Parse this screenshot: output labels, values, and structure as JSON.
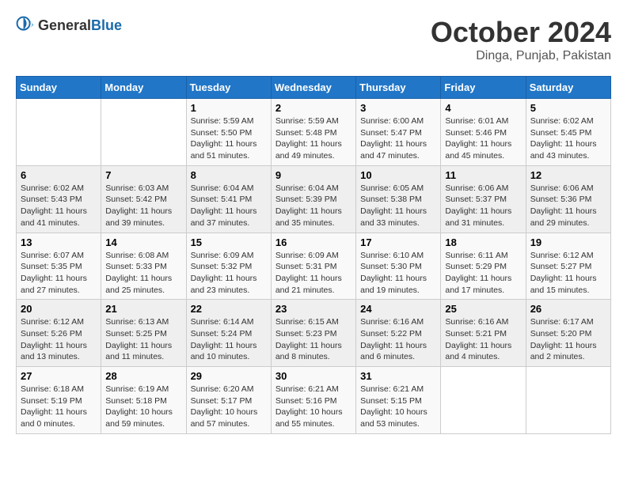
{
  "header": {
    "logo": {
      "general": "General",
      "blue": "Blue"
    },
    "title": "October 2024",
    "location": "Dinga, Punjab, Pakistan"
  },
  "weekdays": [
    "Sunday",
    "Monday",
    "Tuesday",
    "Wednesday",
    "Thursday",
    "Friday",
    "Saturday"
  ],
  "weeks": [
    [
      {
        "day": null
      },
      {
        "day": null
      },
      {
        "day": 1,
        "sunrise": "Sunrise: 5:59 AM",
        "sunset": "Sunset: 5:50 PM",
        "daylight": "Daylight: 11 hours and 51 minutes."
      },
      {
        "day": 2,
        "sunrise": "Sunrise: 5:59 AM",
        "sunset": "Sunset: 5:48 PM",
        "daylight": "Daylight: 11 hours and 49 minutes."
      },
      {
        "day": 3,
        "sunrise": "Sunrise: 6:00 AM",
        "sunset": "Sunset: 5:47 PM",
        "daylight": "Daylight: 11 hours and 47 minutes."
      },
      {
        "day": 4,
        "sunrise": "Sunrise: 6:01 AM",
        "sunset": "Sunset: 5:46 PM",
        "daylight": "Daylight: 11 hours and 45 minutes."
      },
      {
        "day": 5,
        "sunrise": "Sunrise: 6:02 AM",
        "sunset": "Sunset: 5:45 PM",
        "daylight": "Daylight: 11 hours and 43 minutes."
      }
    ],
    [
      {
        "day": 6,
        "sunrise": "Sunrise: 6:02 AM",
        "sunset": "Sunset: 5:43 PM",
        "daylight": "Daylight: 11 hours and 41 minutes."
      },
      {
        "day": 7,
        "sunrise": "Sunrise: 6:03 AM",
        "sunset": "Sunset: 5:42 PM",
        "daylight": "Daylight: 11 hours and 39 minutes."
      },
      {
        "day": 8,
        "sunrise": "Sunrise: 6:04 AM",
        "sunset": "Sunset: 5:41 PM",
        "daylight": "Daylight: 11 hours and 37 minutes."
      },
      {
        "day": 9,
        "sunrise": "Sunrise: 6:04 AM",
        "sunset": "Sunset: 5:39 PM",
        "daylight": "Daylight: 11 hours and 35 minutes."
      },
      {
        "day": 10,
        "sunrise": "Sunrise: 6:05 AM",
        "sunset": "Sunset: 5:38 PM",
        "daylight": "Daylight: 11 hours and 33 minutes."
      },
      {
        "day": 11,
        "sunrise": "Sunrise: 6:06 AM",
        "sunset": "Sunset: 5:37 PM",
        "daylight": "Daylight: 11 hours and 31 minutes."
      },
      {
        "day": 12,
        "sunrise": "Sunrise: 6:06 AM",
        "sunset": "Sunset: 5:36 PM",
        "daylight": "Daylight: 11 hours and 29 minutes."
      }
    ],
    [
      {
        "day": 13,
        "sunrise": "Sunrise: 6:07 AM",
        "sunset": "Sunset: 5:35 PM",
        "daylight": "Daylight: 11 hours and 27 minutes."
      },
      {
        "day": 14,
        "sunrise": "Sunrise: 6:08 AM",
        "sunset": "Sunset: 5:33 PM",
        "daylight": "Daylight: 11 hours and 25 minutes."
      },
      {
        "day": 15,
        "sunrise": "Sunrise: 6:09 AM",
        "sunset": "Sunset: 5:32 PM",
        "daylight": "Daylight: 11 hours and 23 minutes."
      },
      {
        "day": 16,
        "sunrise": "Sunrise: 6:09 AM",
        "sunset": "Sunset: 5:31 PM",
        "daylight": "Daylight: 11 hours and 21 minutes."
      },
      {
        "day": 17,
        "sunrise": "Sunrise: 6:10 AM",
        "sunset": "Sunset: 5:30 PM",
        "daylight": "Daylight: 11 hours and 19 minutes."
      },
      {
        "day": 18,
        "sunrise": "Sunrise: 6:11 AM",
        "sunset": "Sunset: 5:29 PM",
        "daylight": "Daylight: 11 hours and 17 minutes."
      },
      {
        "day": 19,
        "sunrise": "Sunrise: 6:12 AM",
        "sunset": "Sunset: 5:27 PM",
        "daylight": "Daylight: 11 hours and 15 minutes."
      }
    ],
    [
      {
        "day": 20,
        "sunrise": "Sunrise: 6:12 AM",
        "sunset": "Sunset: 5:26 PM",
        "daylight": "Daylight: 11 hours and 13 minutes."
      },
      {
        "day": 21,
        "sunrise": "Sunrise: 6:13 AM",
        "sunset": "Sunset: 5:25 PM",
        "daylight": "Daylight: 11 hours and 11 minutes."
      },
      {
        "day": 22,
        "sunrise": "Sunrise: 6:14 AM",
        "sunset": "Sunset: 5:24 PM",
        "daylight": "Daylight: 11 hours and 10 minutes."
      },
      {
        "day": 23,
        "sunrise": "Sunrise: 6:15 AM",
        "sunset": "Sunset: 5:23 PM",
        "daylight": "Daylight: 11 hours and 8 minutes."
      },
      {
        "day": 24,
        "sunrise": "Sunrise: 6:16 AM",
        "sunset": "Sunset: 5:22 PM",
        "daylight": "Daylight: 11 hours and 6 minutes."
      },
      {
        "day": 25,
        "sunrise": "Sunrise: 6:16 AM",
        "sunset": "Sunset: 5:21 PM",
        "daylight": "Daylight: 11 hours and 4 minutes."
      },
      {
        "day": 26,
        "sunrise": "Sunrise: 6:17 AM",
        "sunset": "Sunset: 5:20 PM",
        "daylight": "Daylight: 11 hours and 2 minutes."
      }
    ],
    [
      {
        "day": 27,
        "sunrise": "Sunrise: 6:18 AM",
        "sunset": "Sunset: 5:19 PM",
        "daylight": "Daylight: 11 hours and 0 minutes."
      },
      {
        "day": 28,
        "sunrise": "Sunrise: 6:19 AM",
        "sunset": "Sunset: 5:18 PM",
        "daylight": "Daylight: 10 hours and 59 minutes."
      },
      {
        "day": 29,
        "sunrise": "Sunrise: 6:20 AM",
        "sunset": "Sunset: 5:17 PM",
        "daylight": "Daylight: 10 hours and 57 minutes."
      },
      {
        "day": 30,
        "sunrise": "Sunrise: 6:21 AM",
        "sunset": "Sunset: 5:16 PM",
        "daylight": "Daylight: 10 hours and 55 minutes."
      },
      {
        "day": 31,
        "sunrise": "Sunrise: 6:21 AM",
        "sunset": "Sunset: 5:15 PM",
        "daylight": "Daylight: 10 hours and 53 minutes."
      },
      {
        "day": null
      },
      {
        "day": null
      }
    ]
  ]
}
